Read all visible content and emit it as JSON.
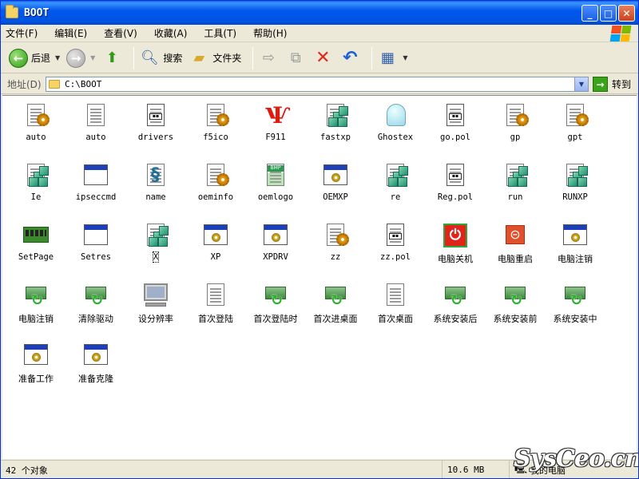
{
  "window": {
    "title": "BOOT"
  },
  "menu": {
    "items": [
      "文件(F)",
      "编辑(E)",
      "查看(V)",
      "收藏(A)",
      "工具(T)",
      "帮助(H)"
    ]
  },
  "toolbar": {
    "back_label": "后退",
    "search_label": "搜索",
    "folders_label": "文件夹"
  },
  "address": {
    "label": "地址(D)",
    "value": "C:\\BOOT",
    "go_label": "转到"
  },
  "files": [
    {
      "name": "auto",
      "icon": "config-settings-icon"
    },
    {
      "name": "auto",
      "icon": "text-file-icon"
    },
    {
      "name": "drivers",
      "icon": "app-file-icon"
    },
    {
      "name": "f5ico",
      "icon": "config-settings-icon"
    },
    {
      "name": "F911",
      "icon": "f911-red-icon"
    },
    {
      "name": "fastxp",
      "icon": "registry-icon"
    },
    {
      "name": "Ghostex",
      "icon": "ghost-icon"
    },
    {
      "name": "go.pol",
      "icon": "app-file-icon"
    },
    {
      "name": "gp",
      "icon": "config-settings-icon"
    },
    {
      "name": "gpt",
      "icon": "config-settings-icon"
    },
    {
      "name": "Ie",
      "icon": "registry-icon"
    },
    {
      "name": "ipseccmd",
      "icon": "window-app-icon"
    },
    {
      "name": "name",
      "icon": "script-icon"
    },
    {
      "name": "oeminfo",
      "icon": "config-settings-icon"
    },
    {
      "name": "oemlogo",
      "icon": "bmp-image-icon"
    },
    {
      "name": "OEMXP",
      "icon": "window-gear-icon"
    },
    {
      "name": "re",
      "icon": "registry-icon"
    },
    {
      "name": "Reg.pol",
      "icon": "app-file-icon"
    },
    {
      "name": "run",
      "icon": "registry-icon"
    },
    {
      "name": "RUNXP",
      "icon": "registry-icon"
    },
    {
      "name": "SetPage",
      "icon": "memory-chip-icon"
    },
    {
      "name": "Setres",
      "icon": "window-app-icon"
    },
    {
      "name": "X",
      "icon": "registry-icon"
    },
    {
      "name": "XP",
      "icon": "window-gear-icon"
    },
    {
      "name": "XPDRV",
      "icon": "window-gear-icon"
    },
    {
      "name": "zz",
      "icon": "config-settings-icon"
    },
    {
      "name": "zz.pol",
      "icon": "app-file-icon"
    },
    {
      "name": "电脑关机",
      "icon": "power-off-icon"
    },
    {
      "name": "电脑重启",
      "icon": "restart-icon"
    },
    {
      "name": "电脑注销",
      "icon": "window-gear-icon"
    },
    {
      "name": "电脑注销",
      "icon": "network-shortcut-icon"
    },
    {
      "name": "清除驱动",
      "icon": "network-shortcut-icon"
    },
    {
      "name": "设分辨率",
      "icon": "monitor-icon"
    },
    {
      "name": "首次登陆",
      "icon": "text-file-icon"
    },
    {
      "name": "首次登陆时",
      "icon": "network-shortcut-icon"
    },
    {
      "name": "首次进桌面",
      "icon": "network-shortcut-icon"
    },
    {
      "name": "首次桌面",
      "icon": "text-file-icon"
    },
    {
      "name": "系统安装后",
      "icon": "network-shortcut-icon"
    },
    {
      "name": "系统安装前",
      "icon": "network-shortcut-icon"
    },
    {
      "name": "系统安装中",
      "icon": "network-shortcut-icon"
    },
    {
      "name": "准备工作",
      "icon": "window-gear-icon"
    },
    {
      "name": "准备克隆",
      "icon": "window-gear-icon"
    }
  ],
  "status": {
    "count": "42 个对象",
    "size": "10.6 MB",
    "location": "我的电脑"
  },
  "watermark": "SysCeo.cn",
  "colors": {
    "titlebar": "#0058ee",
    "content_bg": "#ffffff",
    "chrome": "#ece9d8"
  }
}
